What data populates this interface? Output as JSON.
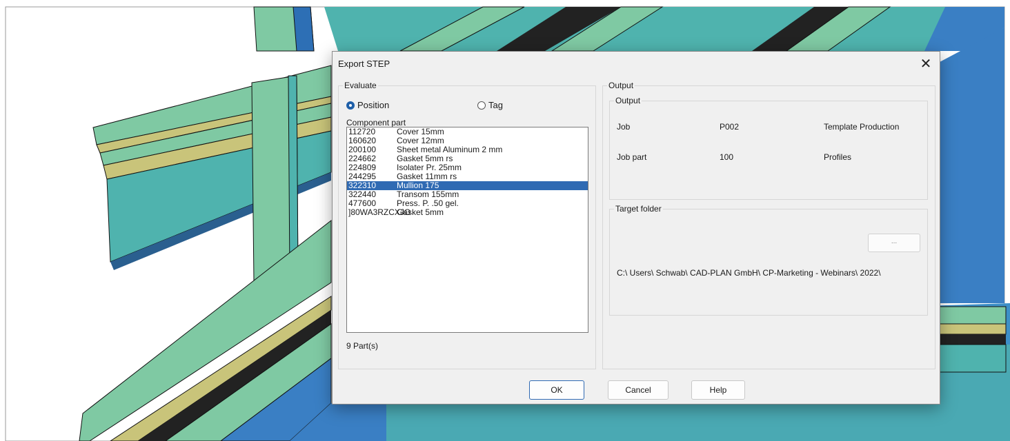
{
  "dialog": {
    "title": "Export STEP",
    "close_glyph": "✕",
    "evaluate": {
      "label": "Evaluate",
      "radio_position": "Position",
      "radio_tag": "Tag",
      "selected": "Position"
    },
    "component_part": {
      "label": "Component part",
      "items": [
        {
          "code": "112720",
          "name": "Cover 15mm",
          "selected": false
        },
        {
          "code": "160620",
          "name": "Cover 12mm",
          "selected": false
        },
        {
          "code": "200100",
          "name": "Sheet metal Aluminum 2 mm",
          "selected": false
        },
        {
          "code": "224662",
          "name": "Gasket 5mm rs",
          "selected": false
        },
        {
          "code": "224809",
          "name": "Isolater Pr. 25mm",
          "selected": false
        },
        {
          "code": "244295",
          "name": "Gasket 11mm rs",
          "selected": false
        },
        {
          "code": "322310",
          "name": "Mullion 175",
          "selected": true
        },
        {
          "code": "322440",
          "name": "Transom 155mm",
          "selected": false
        },
        {
          "code": "477600",
          "name": "Press. P. .50 gel.",
          "selected": false
        },
        {
          "code": "]80WA3RZCXJO",
          "name": "Gasket 5mm",
          "selected": false
        }
      ],
      "count_text": "9 Part(s)"
    },
    "output": {
      "outer_label": "Output",
      "inner_label": "Output",
      "job_label": "Job",
      "job_value": "P002",
      "job_desc": "Template Production",
      "jobpart_label": "Job part",
      "jobpart_value": "100",
      "jobpart_desc": "Profiles",
      "target_label": "Target folder",
      "browse_label": "...",
      "target_path": "C:\\ Users\\ Schwab\\ CAD-PLAN GmbH\\ CP-Marketing - Webinars\\ 2022\\"
    },
    "buttons": {
      "ok": "OK",
      "cancel": "Cancel",
      "help": "Help"
    }
  },
  "colors": {
    "accent": "#2f6ab3",
    "profile_green": "#7fc9a3",
    "profile_teal": "#4fb3ae",
    "profile_blue": "#3a7fc4",
    "profile_olive": "#c9c47a"
  }
}
